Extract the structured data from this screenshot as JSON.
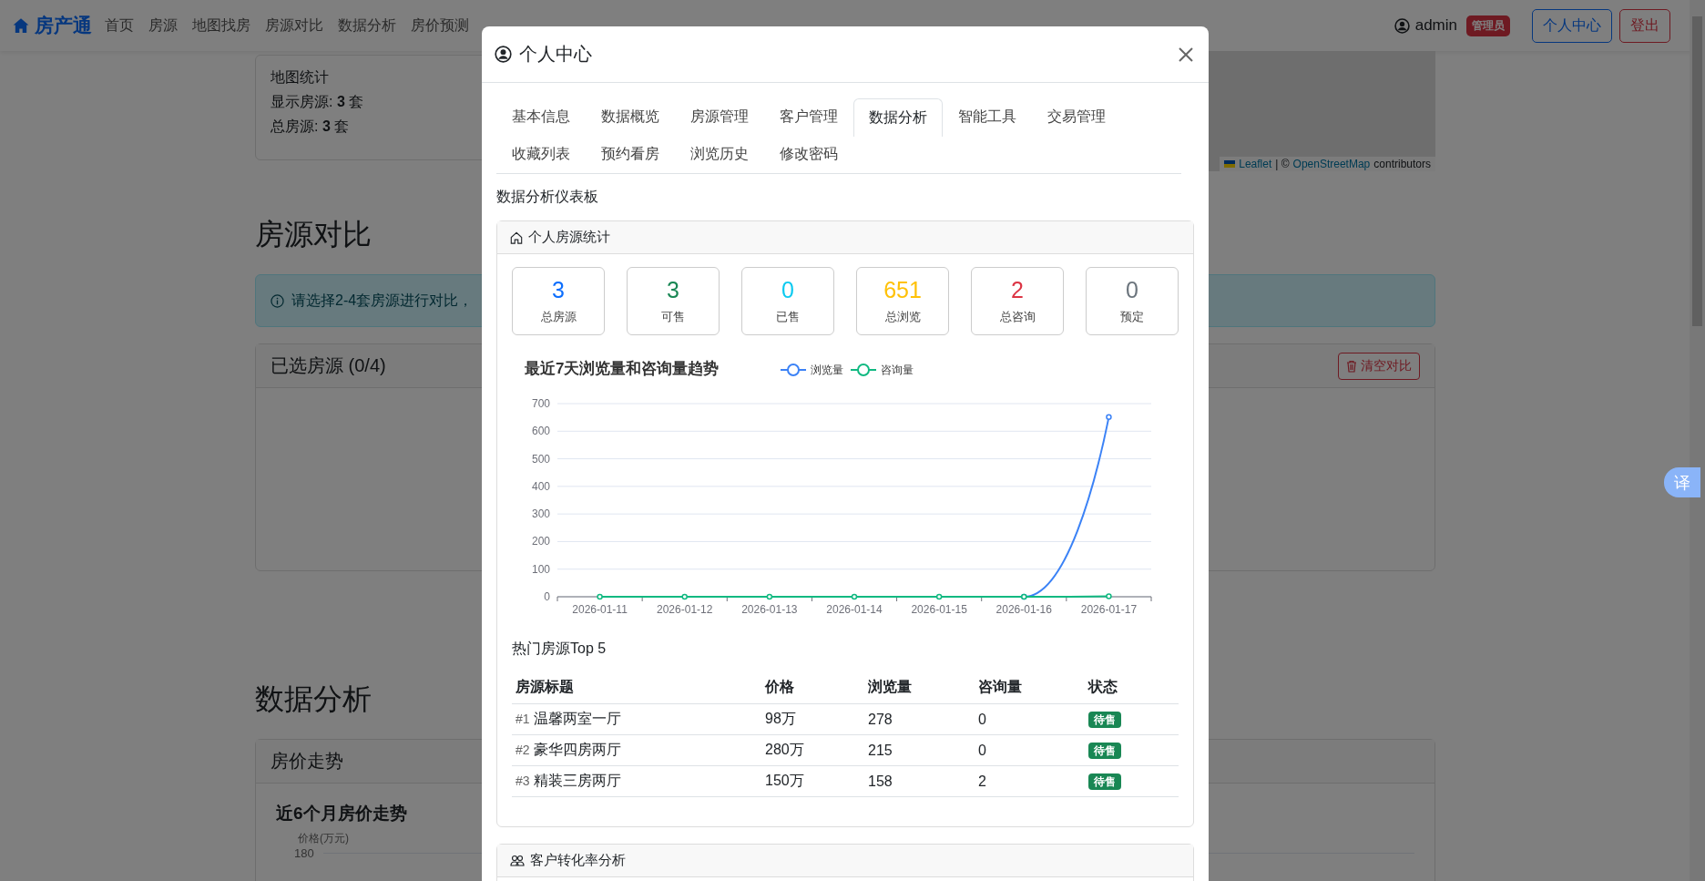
{
  "navbar": {
    "brand": "房产通",
    "links": [
      "首页",
      "房源",
      "地图找房",
      "房源对比",
      "数据分析",
      "房价预测"
    ],
    "user": "admin",
    "role_badge": "管理员",
    "buttons": [
      "个人中心",
      "登出"
    ]
  },
  "map_stats": {
    "title": "地图统计",
    "lines": [
      "显示房源: **3** 套",
      "总房源: **3** 套"
    ]
  },
  "map": {
    "link_1": "Leaflet",
    "separator": "| ©",
    "link_2": "OpenStreetMap",
    "text": "contributors"
  },
  "compare": {
    "heading": "房源对比",
    "alert": "请选择2-4套房源进行对比，",
    "card_title": "已选房源 (0/4)",
    "clear_button": "清空对比"
  },
  "analysis": {
    "heading": "数据分析",
    "card_title": "房价走势",
    "chart_title": "近6个月房价走势",
    "axis_label": "价格(万元)",
    "tick": "180"
  },
  "modal": {
    "title": "个人中心",
    "tabs": [
      {
        "label": "基本信息",
        "selected": false
      },
      {
        "label": "数据概览",
        "selected": false
      },
      {
        "label": "房源管理",
        "selected": false
      },
      {
        "label": "客户管理",
        "selected": false
      },
      {
        "label": "数据分析",
        "selected": true
      },
      {
        "label": "智能工具",
        "selected": false
      },
      {
        "label": "交易管理",
        "selected": false
      },
      {
        "label": "收藏列表",
        "selected": false
      },
      {
        "label": "预约看房",
        "selected": false
      },
      {
        "label": "浏览历史",
        "selected": false
      },
      {
        "label": "修改密码",
        "selected": false
      }
    ],
    "section_title": "数据分析仪表板",
    "stats_card": {
      "title": "个人房源统计",
      "stats": [
        {
          "value": "3",
          "label": "总房源",
          "color": "#0d6efd"
        },
        {
          "value": "3",
          "label": "可售",
          "color": "#198754"
        },
        {
          "value": "0",
          "label": "已售",
          "color": "#0dcaf0"
        },
        {
          "value": "651",
          "label": "总浏览",
          "color": "#ffc107"
        },
        {
          "value": "2",
          "label": "总咨询",
          "color": "#dc3545"
        },
        {
          "value": "0",
          "label": "预定",
          "color": "#6c757d"
        }
      ],
      "chart_data": {
        "type": "line",
        "title": "最近7天浏览量和咨询量趋势",
        "categories": [
          "2026-01-11",
          "2026-01-12",
          "2026-01-13",
          "2026-01-14",
          "2026-01-15",
          "2026-01-16",
          "2026-01-17"
        ],
        "series": [
          {
            "name": "浏览量",
            "color": "#3b82f6",
            "marker": "circle",
            "values": [
              null,
              null,
              null,
              null,
              null,
              0,
              651
            ]
          },
          {
            "name": "咨询量",
            "color": "#10b981",
            "marker": "circle",
            "values": [
              0,
              0,
              0,
              0,
              0,
              0,
              2
            ]
          }
        ],
        "grid": true,
        "legend": true,
        "ylim": [
          0,
          700
        ],
        "yticks": [
          0,
          100,
          200,
          300,
          400,
          500,
          600,
          700
        ]
      },
      "top_title": "热门房源Top 5",
      "table": {
        "columns": [
          "房源标题",
          "价格",
          "浏览量",
          "咨询量",
          "状态"
        ],
        "rows": [
          {
            "rank": "#1",
            "title": "温馨两室一厅",
            "price": "98万",
            "views": "278",
            "inquiries": "0",
            "status": "待售"
          },
          {
            "rank": "#2",
            "title": "豪华四房两厅",
            "price": "280万",
            "views": "215",
            "inquiries": "0",
            "status": "待售"
          },
          {
            "rank": "#3",
            "title": "精装三房两厅",
            "price": "150万",
            "views": "158",
            "inquiries": "2",
            "status": "待售"
          }
        ]
      }
    },
    "conversion_card": {
      "title": "客户转化率分析"
    }
  },
  "translate_button": "译"
}
